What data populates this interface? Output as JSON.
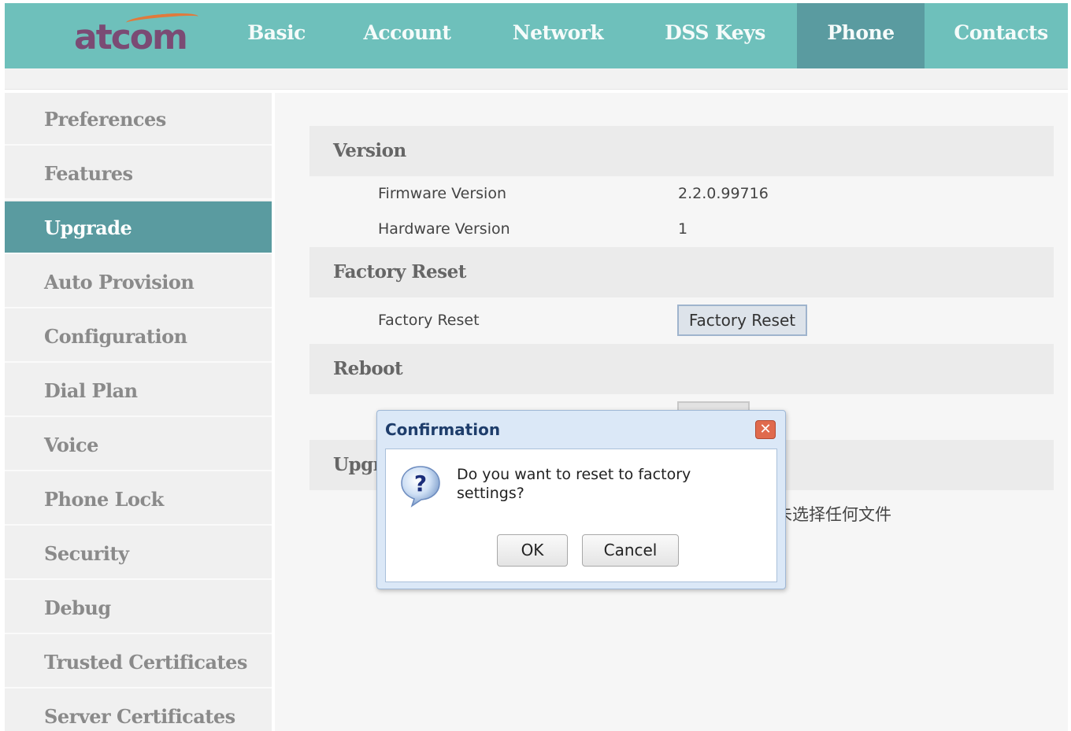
{
  "brand": {
    "logo_text": "atcom",
    "logo_color": "#7b4b74",
    "swoosh_color": "#e07a3c"
  },
  "nav": {
    "tabs": [
      {
        "label": "Basic"
      },
      {
        "label": "Account"
      },
      {
        "label": "Network"
      },
      {
        "label": "DSS Keys"
      },
      {
        "label": "Phone",
        "active": true
      },
      {
        "label": "Contacts"
      }
    ]
  },
  "sidebar": {
    "items": [
      {
        "label": "Preferences"
      },
      {
        "label": "Features"
      },
      {
        "label": "Upgrade",
        "active": true
      },
      {
        "label": "Auto Provision"
      },
      {
        "label": "Configuration"
      },
      {
        "label": "Dial Plan"
      },
      {
        "label": "Voice"
      },
      {
        "label": "Phone Lock"
      },
      {
        "label": "Security"
      },
      {
        "label": "Debug"
      },
      {
        "label": "Trusted Certificates"
      },
      {
        "label": "Server Certificates"
      }
    ]
  },
  "main": {
    "version": {
      "title": "Version",
      "firmware_label": "Firmware Version",
      "firmware_value": "2.2.0.99716",
      "hardware_label": "Hardware Version",
      "hardware_value": "1"
    },
    "factory_reset": {
      "title": "Factory Reset",
      "row_label": "Factory Reset",
      "button_label": "Factory Reset"
    },
    "reboot": {
      "title": "Reboot"
    },
    "upgrade": {
      "title_partial": "Upgr",
      "file_status": "未选择任何文件"
    }
  },
  "dialog": {
    "title": "Confirmation",
    "close_icon": "close-icon",
    "question_icon": "question-icon",
    "message": "Do you want to reset to factory settings?",
    "ok_label": "OK",
    "cancel_label": "Cancel"
  },
  "colors": {
    "nav_bg": "#6ec0bb",
    "nav_active": "#5a9ba0",
    "sidebar_bg": "#f0f0f0",
    "sidebar_active": "#5a9ba0"
  }
}
